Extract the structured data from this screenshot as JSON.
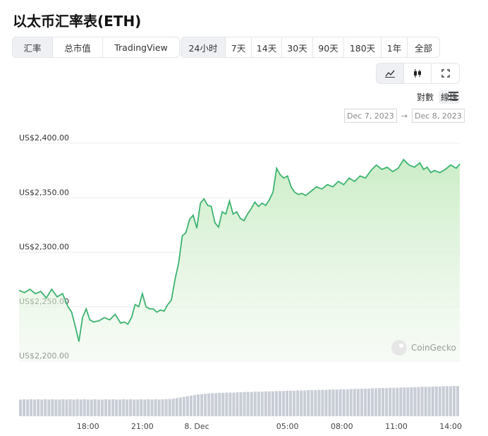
{
  "title": "以太币汇率表(ETH)",
  "tabs": {
    "items": [
      "汇率",
      "总市值",
      "TradingView"
    ],
    "active": 0
  },
  "ranges": {
    "items": [
      "24小时",
      "7天",
      "14天",
      "30天",
      "90天",
      "180天",
      "1年",
      "全部"
    ],
    "active": 0
  },
  "chart_controls": {
    "icons": [
      "line-chart-icon",
      "candlestick-icon",
      "fullscreen-icon"
    ],
    "active": 0
  },
  "scale": {
    "log_label": "對數",
    "linear_label": "線性",
    "active": "linear"
  },
  "date_range": {
    "from": "Dec 7, 2023",
    "separator": "→",
    "to": "Dec 8, 2023"
  },
  "watermark": "CoinGecko",
  "colors": {
    "line": "#3cb371",
    "fill_top": "#c9ecc4",
    "volume": "#c8cdd6",
    "grid": "#ececec"
  },
  "chart_data": {
    "type": "area",
    "title": "",
    "xlabel": "",
    "ylabel": "",
    "y_tick_labels": [
      "US$2,400.00",
      "US$2,350.00",
      "US$2,300.00",
      "US$2,250.00",
      "US$2,200.00"
    ],
    "y_ticks": [
      2400,
      2350,
      2300,
      2250,
      2200
    ],
    "ylim": [
      2200,
      2400
    ],
    "x_tick_labels": [
      "18:00",
      "21:00",
      "8. Dec",
      "05:00",
      "08:00",
      "11:00",
      "14:00"
    ],
    "x_ticks": [
      18,
      21,
      24,
      29,
      32,
      35,
      38
    ],
    "xlim": [
      14.2,
      38.5
    ],
    "grid": true,
    "series": [
      {
        "x": [
          14.2,
          14.5,
          14.8,
          15.1,
          15.4,
          15.7,
          16.0,
          16.3,
          16.6,
          16.9,
          17.1,
          17.3,
          17.5,
          17.7,
          17.9,
          18.1,
          18.3,
          18.6,
          18.9,
          19.2,
          19.5,
          19.8,
          20.0,
          20.2,
          20.4,
          20.6,
          20.8,
          21.0,
          21.2,
          21.4,
          21.6,
          21.8,
          22.0,
          22.2,
          22.4,
          22.6,
          22.8,
          23.0,
          23.2,
          23.4,
          23.6,
          23.8,
          24.0,
          24.2,
          24.4,
          24.6,
          24.8,
          25.0,
          25.2,
          25.4,
          25.6,
          25.8,
          26.0,
          26.2,
          26.4,
          26.6,
          26.8,
          27.0,
          27.2,
          27.4,
          27.6,
          27.8,
          28.0,
          28.2,
          28.4,
          28.6,
          28.8,
          29.0,
          29.2,
          29.4,
          29.6,
          29.8,
          30.0,
          30.3,
          30.6,
          30.9,
          31.2,
          31.5,
          31.8,
          32.1,
          32.4,
          32.7,
          33.0,
          33.3,
          33.6,
          33.9,
          34.2,
          34.5,
          34.8,
          35.1,
          35.4,
          35.7,
          36.0,
          36.3,
          36.5,
          36.7,
          36.9,
          37.1,
          37.4,
          37.7,
          38.0,
          38.3,
          38.5
        ],
        "y": [
          2265,
          2263,
          2266,
          2262,
          2264,
          2258,
          2266,
          2259,
          2262,
          2250,
          2245,
          2232,
          2218,
          2240,
          2248,
          2238,
          2236,
          2237,
          2240,
          2238,
          2243,
          2235,
          2236,
          2234,
          2240,
          2252,
          2250,
          2262,
          2250,
          2248,
          2248,
          2245,
          2247,
          2246,
          2252,
          2256,
          2275,
          2290,
          2315,
          2318,
          2330,
          2334,
          2322,
          2345,
          2349,
          2343,
          2342,
          2327,
          2323,
          2337,
          2335,
          2347,
          2335,
          2337,
          2331,
          2329,
          2335,
          2340,
          2346,
          2342,
          2345,
          2343,
          2348,
          2355,
          2377,
          2371,
          2368,
          2370,
          2360,
          2355,
          2353,
          2354,
          2352,
          2356,
          2360,
          2358,
          2362,
          2360,
          2365,
          2362,
          2368,
          2365,
          2370,
          2368,
          2375,
          2380,
          2376,
          2378,
          2374,
          2377,
          2385,
          2380,
          2378,
          2382,
          2376,
          2378,
          2373,
          2375,
          2373,
          2376,
          2380,
          2377,
          2381
        ]
      }
    ],
    "volume": [
      0.55,
      0.56,
      0.55,
      0.56,
      0.55,
      0.56,
      0.55,
      0.56,
      0.55,
      0.56,
      0.55,
      0.55,
      0.56,
      0.55,
      0.56,
      0.55,
      0.56,
      0.55,
      0.56,
      0.55,
      0.55,
      0.56,
      0.55,
      0.55,
      0.56,
      0.55,
      0.56,
      0.55,
      0.55,
      0.56,
      0.55,
      0.56,
      0.55,
      0.55,
      0.56,
      0.55,
      0.56,
      0.55,
      0.56,
      0.55,
      0.56,
      0.56,
      0.57,
      0.58,
      0.6,
      0.62,
      0.64,
      0.66,
      0.68,
      0.7,
      0.72,
      0.73,
      0.74,
      0.75,
      0.76,
      0.76,
      0.77,
      0.77,
      0.78,
      0.78,
      0.78,
      0.79,
      0.79,
      0.8,
      0.8,
      0.8,
      0.81,
      0.81,
      0.81,
      0.82,
      0.82,
      0.82,
      0.83,
      0.83,
      0.83,
      0.84,
      0.84,
      0.84,
      0.85,
      0.85,
      0.85,
      0.86,
      0.86,
      0.86,
      0.87,
      0.87,
      0.87,
      0.88,
      0.88,
      0.88,
      0.89,
      0.89,
      0.89,
      0.9,
      0.9,
      0.9,
      0.91,
      0.91,
      0.91,
      0.92,
      0.92,
      0.93,
      0.93,
      0.93,
      0.94,
      0.94,
      0.94,
      0.95,
      0.95,
      0.95,
      0.96,
      0.96,
      0.96,
      0.97,
      0.97,
      0.97,
      0.98,
      0.98,
      0.98,
      0.99,
      0.99,
      0.99,
      1.0,
      1.0
    ]
  }
}
